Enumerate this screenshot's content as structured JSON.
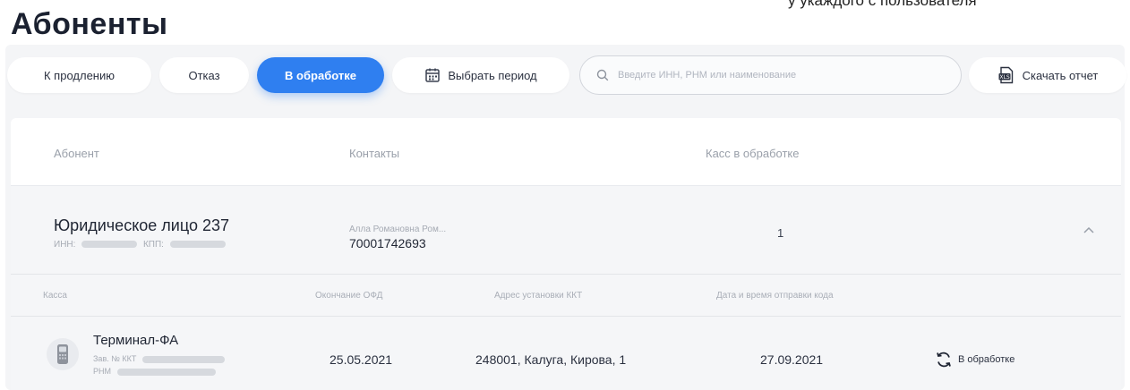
{
  "top_cut_text": "у укаждого с пользователя",
  "page_title": "Абоненты",
  "toolbar": {
    "tabs": [
      {
        "label": "К продлению"
      },
      {
        "label": "Отказ"
      },
      {
        "label": "В обработке",
        "active": true
      }
    ],
    "period_label": "Выбрать период",
    "search_placeholder": "Введите ИНН, РНМ или наименование",
    "download_label": "Скачать отчет"
  },
  "table": {
    "columns": [
      "Абонент",
      "Контакты",
      "Касс в обработке"
    ],
    "groups": [
      {
        "name": "Юридическое лицо 237",
        "inn_label": "ИНН:",
        "kpp_label": "КПП:",
        "contact_name": "Алла Романовна Ром...",
        "contact_phone": "70001742693",
        "count": "1",
        "expanded": true,
        "sub_columns": [
          "Касса",
          "Окончание ОФД",
          "Адрес установки ККТ",
          "Дата и время отправки кода"
        ],
        "rows": [
          {
            "name": "Терминал-ФА",
            "serial_label": "Зав. № ККТ",
            "rnm_label": "РНМ",
            "ofd_end": "25.05.2021",
            "address": "248001, Калуга, Кирова, 1",
            "sent_date": "27.09.2021",
            "status": "В обработке"
          }
        ]
      }
    ]
  },
  "colors": {
    "accent": "#2f7ff0",
    "panel_bg": "#f4f5f7",
    "muted_text": "#9aa0aa"
  },
  "icons": [
    "search-icon",
    "calendar-icon",
    "xls-file-icon",
    "chevron-up-icon",
    "terminal-device-icon",
    "refresh-icon"
  ]
}
